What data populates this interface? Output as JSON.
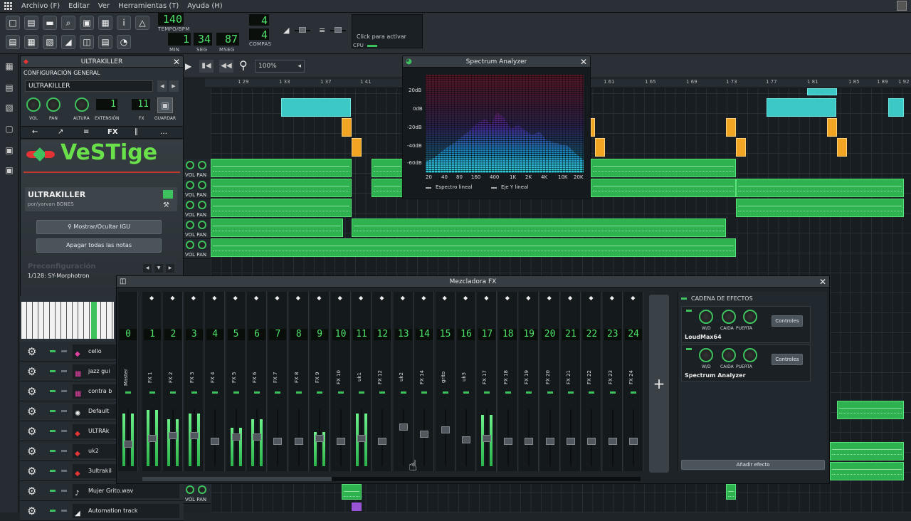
{
  "menu": [
    "Archivo (F)",
    "Editar",
    "Ver",
    "Herramientas (T)",
    "Ayuda (H)"
  ],
  "toolbar": {
    "tempo": "140",
    "tempo_label": "TEMPO/BPM",
    "min": "1",
    "sec": "34",
    "msec": "87",
    "min_label": "MIN",
    "sec_label": "SEG",
    "msec_label": "MSEG",
    "time_sig_num": "4",
    "time_sig_den": "4",
    "time_sig_label": "COMPAS",
    "cpu_hint": "Click para activar",
    "cpu_label": "CPU"
  },
  "song_editor": {
    "zoom": "100%",
    "ruler": [
      "1 29",
      "1 33",
      "1 37",
      "1 41",
      "1 61",
      "1 65",
      "1 69",
      "1 73",
      "1 77",
      "1 81",
      "1 85",
      "1 89",
      "1 92"
    ]
  },
  "ultrakiller": {
    "title": "ULTRAKILLER",
    "section": "CONFIGURACIÓN GENERAL",
    "instrument_name": "ULTRAKILLER",
    "knob_labels": [
      "VOL",
      "PAN",
      "ALTURA",
      "EXTENSIÓN",
      "FX",
      "GUARDAR"
    ],
    "pitch_value": "1",
    "fx_value": "11",
    "tabs": [
      "←",
      "↗",
      "≡",
      "FX",
      "∥",
      "…"
    ],
    "logo": "VeSTige",
    "plugin_name": "ULTRAKILLER",
    "plugin_author": "por/yarvan BONES",
    "btn_show": "Mostrar/Ocultar IGU",
    "btn_notes_off": "Apagar todas las notas",
    "preset_label": "Preconfiguración",
    "preset_value": "1/128: SY-Morphotron"
  },
  "spectrum": {
    "title": "Spectrum Analyzer",
    "y_labels": [
      "20dB",
      "0dB",
      "-20dB",
      "-40dB",
      "-60dB"
    ],
    "x_labels": [
      "20",
      "40",
      "80",
      "160",
      "400",
      "1K",
      "2K",
      "4K",
      "10K",
      "20K"
    ],
    "legend_1": "Espectro lineal",
    "legend_2": "Eje Y lineal"
  },
  "mixer": {
    "title": "Mezcladora FX",
    "channels": [
      {
        "num": "0",
        "name": "Master"
      },
      {
        "num": "1",
        "name": "FX 1"
      },
      {
        "num": "2",
        "name": "FX 2"
      },
      {
        "num": "3",
        "name": "FX 3"
      },
      {
        "num": "4",
        "name": "FX 4"
      },
      {
        "num": "5",
        "name": "FX 5"
      },
      {
        "num": "6",
        "name": "FX 6"
      },
      {
        "num": "7",
        "name": "FX 7"
      },
      {
        "num": "8",
        "name": "FX 8"
      },
      {
        "num": "9",
        "name": "FX 9"
      },
      {
        "num": "10",
        "name": "FX 10"
      },
      {
        "num": "11",
        "name": "uk1"
      },
      {
        "num": "12",
        "name": "FX 12"
      },
      {
        "num": "13",
        "name": "uk2"
      },
      {
        "num": "14",
        "name": "FX 14"
      },
      {
        "num": "15",
        "name": "grito"
      },
      {
        "num": "16",
        "name": "uk3"
      },
      {
        "num": "17",
        "name": "FX 17"
      },
      {
        "num": "18",
        "name": "FX 18"
      },
      {
        "num": "19",
        "name": "FX 19"
      },
      {
        "num": "20",
        "name": "FX 20"
      },
      {
        "num": "21",
        "name": "FX 21"
      },
      {
        "num": "22",
        "name": "FX 22"
      },
      {
        "num": "23",
        "name": "FX 23"
      },
      {
        "num": "24",
        "name": "FX 24"
      }
    ],
    "add_channel": "+",
    "chain_title": "CADENA DE EFECTOS",
    "plugins": [
      {
        "name": "LoudMax64",
        "knobs": [
          "W/D",
          "CAIDA",
          "PUERTA"
        ],
        "btn": "Controles"
      },
      {
        "name": "Spectrum Analyzer",
        "knobs": [
          "W/D",
          "CAIDA",
          "PUERTA"
        ],
        "btn": "Controles"
      }
    ],
    "add_effect": "Añadir efecto"
  },
  "tracks": [
    {
      "name": "cello"
    },
    {
      "name": "jazz gui"
    },
    {
      "name": "contra b"
    },
    {
      "name": "Default"
    },
    {
      "name": "ULTRAk"
    },
    {
      "name": "uk2"
    },
    {
      "name": "3ultrakil"
    },
    {
      "name": "Mujer Grito.wav"
    },
    {
      "name": "Automation track"
    }
  ],
  "track_knob_labels": "VOL PAN"
}
